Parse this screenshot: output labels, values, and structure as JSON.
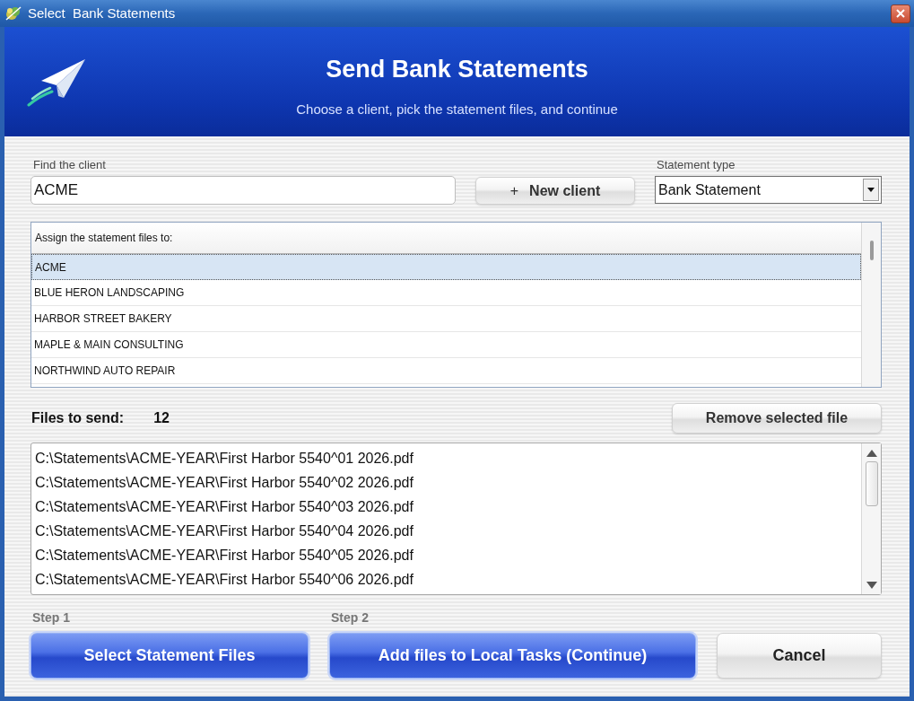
{
  "window": {
    "title": "Select  Bank Statements"
  },
  "header": {
    "title": "Send Bank Statements",
    "subtitle": "Choose a client, pick the statement files, and continue"
  },
  "client_search": {
    "label": "Find the client",
    "value": "ACME"
  },
  "new_client_button": {
    "symbol": "+",
    "label": "New client"
  },
  "statement_type": {
    "label": "Statement type",
    "value": "Bank Statement"
  },
  "client_list": {
    "header": "Assign the statement files to:",
    "rows": [
      {
        "name": "ACME",
        "selected": true
      },
      {
        "name": "BLUE HERON LANDSCAPING",
        "selected": false
      },
      {
        "name": "HARBOR STREET BAKERY",
        "selected": false
      },
      {
        "name": "MAPLE & MAIN CONSULTING",
        "selected": false
      },
      {
        "name": "NORTHWIND AUTO REPAIR",
        "selected": false
      }
    ]
  },
  "files": {
    "label": "Files to send:",
    "count": "12",
    "remove_button": "Remove selected file",
    "items": [
      "C:\\Statements\\ACME-YEAR\\First Harbor 5540^01 2026.pdf",
      "C:\\Statements\\ACME-YEAR\\First Harbor 5540^02 2026.pdf",
      "C:\\Statements\\ACME-YEAR\\First Harbor 5540^03 2026.pdf",
      "C:\\Statements\\ACME-YEAR\\First Harbor 5540^04 2026.pdf",
      "C:\\Statements\\ACME-YEAR\\First Harbor 5540^05 2026.pdf",
      "C:\\Statements\\ACME-YEAR\\First Harbor 5540^06 2026.pdf"
    ]
  },
  "actions": [
    {
      "step": "Step 1",
      "label": "Select Statement Files",
      "kind": "primary"
    },
    {
      "step": "Step 2",
      "label": "Add files to Local Tasks (Continue)",
      "kind": "primary"
    },
    {
      "label": "Cancel",
      "kind": "secondary"
    }
  ]
}
